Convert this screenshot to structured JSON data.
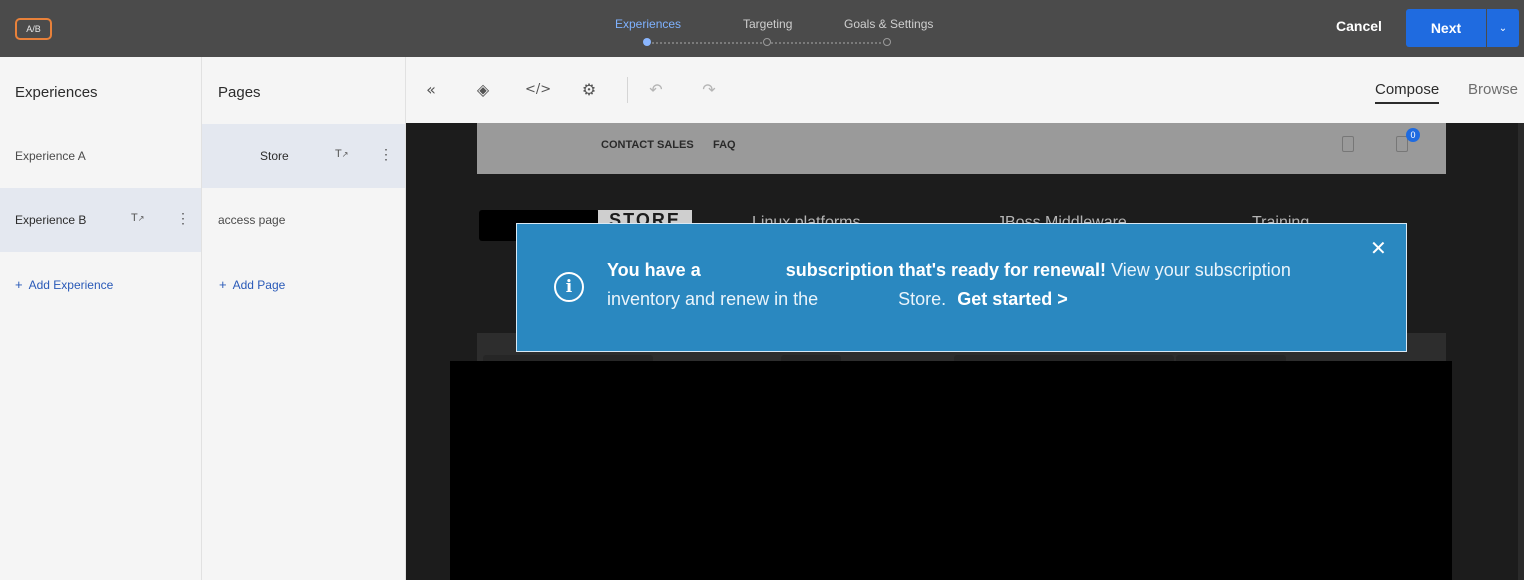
{
  "header": {
    "badge": "A/B",
    "steps": [
      "Experiences",
      "Targeting",
      "Goals & Settings"
    ],
    "cancel_label": "Cancel",
    "next_label": "Next",
    "next_dropdown_icon": "chevron-down-icon"
  },
  "experiences": {
    "title": "Experiences",
    "items": [
      {
        "label": "Experience A"
      },
      {
        "label": "Experience B"
      }
    ],
    "add_label": "Add Experience"
  },
  "pages": {
    "title": "Pages",
    "items": [
      {
        "label": "Store"
      },
      {
        "label": "access page"
      }
    ],
    "add_label": "Add Page"
  },
  "toolbar": {
    "icons": [
      "collapse-icon",
      "layers-icon",
      "code-icon",
      "gear-icon",
      "undo-icon",
      "redo-icon"
    ],
    "compose_label": "Compose",
    "browse_label": "Browse"
  },
  "site": {
    "nav": [
      "CONTACT SALES",
      "FAQ"
    ],
    "cart_count": "0",
    "store_logo": "STORE",
    "menu": [
      "Linux platforms",
      "JBoss Middleware",
      "Training"
    ]
  },
  "banner": {
    "line1_bold_a": "You have a",
    "line1_bold_b": "subscription that's ready for renewal!",
    "line1_rest": "View your subscription",
    "line2_a": "inventory and renew in the",
    "line2_b": "Store.",
    "cta": "Get started >"
  },
  "colors": {
    "topbar": "#4b4b4b",
    "accent_blue": "#1f6be0",
    "active_step": "#7fb2ff",
    "badge_border": "#e8813a",
    "banner": "#2a88c0"
  }
}
